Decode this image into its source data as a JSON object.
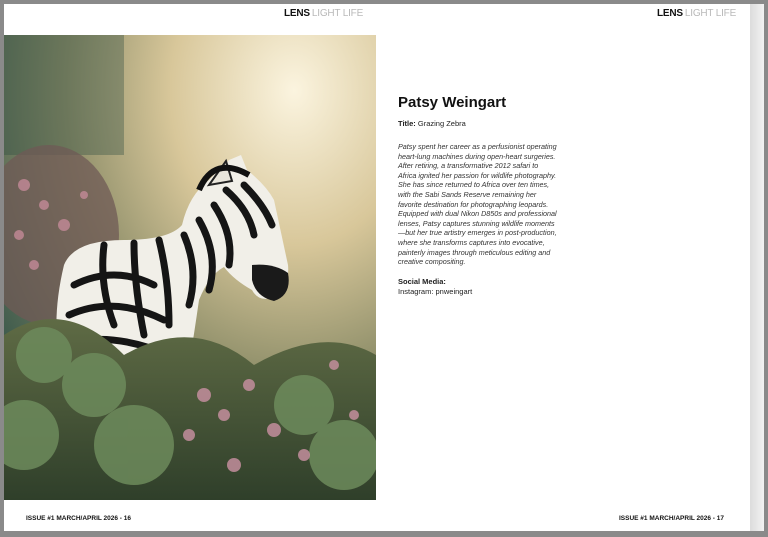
{
  "masthead": {
    "brand": "LENS",
    "tagline": "LIGHT LIFE"
  },
  "photo": {
    "icon": "zebra-photograph"
  },
  "article": {
    "name": "Patsy Weingart",
    "title_label": "Title:",
    "title_value": "Grazing Zebra",
    "bio": "Patsy spent her career as a perfusionist operating heart-lung machines during open-heart surgeries. After retiring, a transformative 2012 safari to Africa ignited her passion for wildlife photography. She has since returned to Africa over ten times, with the Sabi Sands Reserve remaining her favorite destination for photographing leopards. Equipped with dual Nikon D850s and professional lenses, Patsy captures stunning wildlife moments—but her true artistry emerges in post-production, where she transforms captures into evocative, painterly images through meticulous editing and creative compositing.",
    "social_label": "Social Media:",
    "social_value": "Instagram: pnweingart"
  },
  "footer": {
    "left": "ISSUE #1 MARCH/APRIL 2026 - 16",
    "right": "ISSUE #1 MARCH/APRIL 2026 - 17"
  }
}
